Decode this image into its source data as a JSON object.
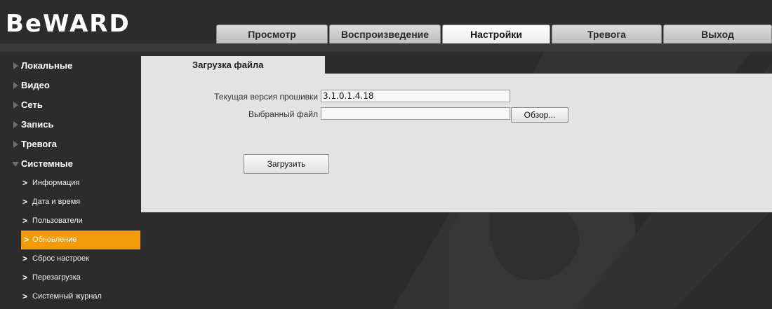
{
  "brand": {
    "logo_text": "BeWARD"
  },
  "tabs": [
    {
      "label": "Просмотр",
      "active": false
    },
    {
      "label": "Воспроизведение",
      "active": false
    },
    {
      "label": "Настройки",
      "active": true
    },
    {
      "label": "Тревога",
      "active": false
    },
    {
      "label": "Выход",
      "active": false
    }
  ],
  "sidebar": {
    "sections": [
      {
        "label": "Локальные",
        "expanded": false
      },
      {
        "label": "Видео",
        "expanded": false
      },
      {
        "label": "Сеть",
        "expanded": false
      },
      {
        "label": "Запись",
        "expanded": false
      },
      {
        "label": "Тревога",
        "expanded": false
      },
      {
        "label": "Системные",
        "expanded": true
      }
    ],
    "sub_items": [
      {
        "label": "Информация",
        "active": false
      },
      {
        "label": "Дата и время",
        "active": false
      },
      {
        "label": "Пользователи",
        "active": false
      },
      {
        "label": "Обновление",
        "active": true
      },
      {
        "label": "Сброс настроек",
        "active": false
      },
      {
        "label": "Перезагрузка",
        "active": false
      },
      {
        "label": "Системный журнал",
        "active": false
      }
    ]
  },
  "panel": {
    "tab_label": "Загрузка файла",
    "firmware_label": "Текущая версия прошивки",
    "firmware_value": "3.1.0.1.4.18",
    "file_label": "Выбранный файл",
    "file_value": "",
    "browse_label": "Обзор...",
    "upload_label": "Загрузить"
  },
  "colors": {
    "background": "#2c2c2c",
    "accent": "#f39a0a",
    "panel": "#e3e3e3"
  }
}
